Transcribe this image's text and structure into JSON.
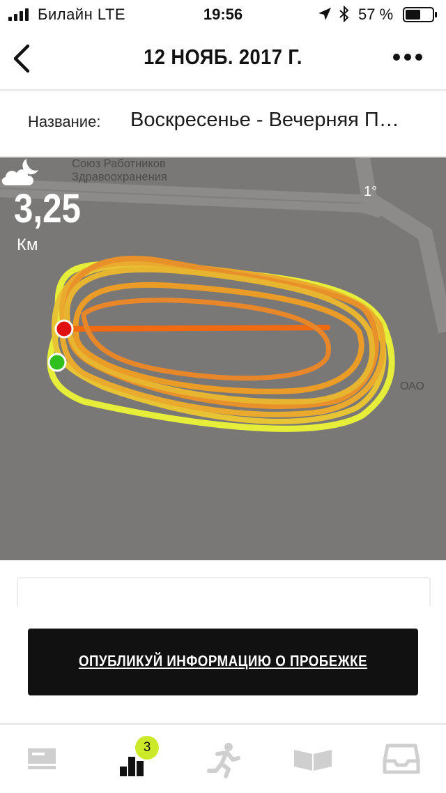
{
  "status_bar": {
    "carrier": "Билайн  LTE",
    "time": "19:56",
    "battery_percent": "57 %",
    "battery_level": 0.57
  },
  "nav": {
    "title": "12 НОЯБ. 2017 Г.",
    "back_icon": "chevron-left-icon",
    "more_icon": "more-horizontal-icon"
  },
  "run_name": {
    "label": "Название:",
    "value": "Воскресенье - Вечерняя П…"
  },
  "map": {
    "street_label": "Союз Работников\nЗдравоохранения",
    "edge_label": "ОАО",
    "distance_value": "3,25",
    "distance_unit": "Км",
    "temperature": "1°",
    "weather_icon": "cloud-moon-icon",
    "route_colors": [
      "#e8e93a",
      "#e8b030",
      "#e88a20",
      "#f06a12"
    ],
    "start_color": "#2fbf1f",
    "end_color": "#e01010"
  },
  "publish": {
    "label": "ОПУБЛИКУЙ ИНФОРМАЦИЮ О ПРОБЕЖКЕ"
  },
  "tabs": [
    {
      "name": "feed",
      "icon": "feed-icon"
    },
    {
      "name": "activity",
      "icon": "bar-chart-icon",
      "badge": "3"
    },
    {
      "name": "run",
      "icon": "runner-icon"
    },
    {
      "name": "coach",
      "icon": "open-book-icon"
    },
    {
      "name": "inbox",
      "icon": "inbox-tray-icon"
    }
  ],
  "colors": {
    "accent_badge": "#cdea2a",
    "button_bg": "#111111",
    "map_bg": "#7a7876"
  }
}
